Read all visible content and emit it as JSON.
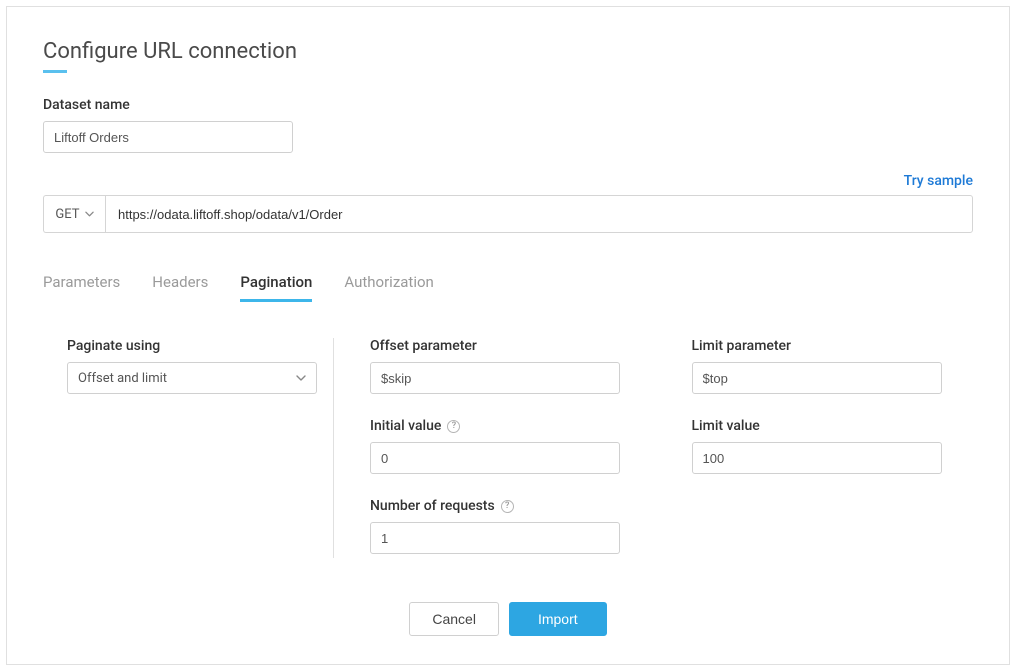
{
  "page": {
    "title": "Configure URL connection"
  },
  "dataset": {
    "label": "Dataset name",
    "value": "Liftoff Orders"
  },
  "trySample": {
    "label": "Try sample"
  },
  "request": {
    "method": "GET",
    "url": "https://odata.liftoff.shop/odata/v1/Order"
  },
  "tabs": {
    "parameters": "Parameters",
    "headers": "Headers",
    "pagination": "Pagination",
    "authorization": "Authorization",
    "active": "pagination"
  },
  "pagination": {
    "paginateUsing": {
      "label": "Paginate using",
      "value": "Offset and limit"
    },
    "offsetParam": {
      "label": "Offset parameter",
      "value": "$skip"
    },
    "limitParam": {
      "label": "Limit parameter",
      "value": "$top"
    },
    "initialValue": {
      "label": "Initial value",
      "value": "0"
    },
    "limitValue": {
      "label": "Limit value",
      "value": "100"
    },
    "numRequests": {
      "label": "Number of requests",
      "value": "1"
    }
  },
  "buttons": {
    "cancel": "Cancel",
    "import": "Import"
  }
}
